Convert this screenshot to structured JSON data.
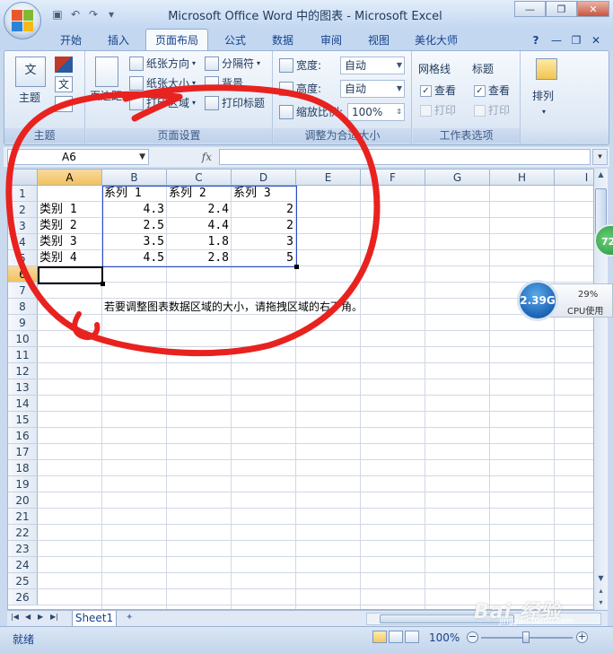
{
  "window": {
    "title": "Microsoft Office Word 中的图表 - Microsoft Excel",
    "minimize_glyph": "—",
    "restore_glyph": "❐",
    "close_glyph": "✕"
  },
  "qat": {
    "save_icon": "save-icon",
    "undo_icon": "undo-icon",
    "redo_icon": "redo-icon",
    "customize_icon": "chevron-down-icon"
  },
  "tabs": [
    {
      "label": "开始"
    },
    {
      "label": "插入"
    },
    {
      "label": "页面布局",
      "active": true
    },
    {
      "label": "公式"
    },
    {
      "label": "数据"
    },
    {
      "label": "审阅"
    },
    {
      "label": "视图"
    },
    {
      "label": "美化大师"
    }
  ],
  "ribbon": {
    "help_glyph": "?",
    "min_glyph": "—",
    "restore_glyph": "❐",
    "close_glyph": "✕",
    "themes": {
      "label": "主题",
      "btn": "主题"
    },
    "page_setup": {
      "label": "页面设置",
      "margins": "页边距",
      "orientation": "纸张方向",
      "size": "纸张大小",
      "print_area": "打印区域",
      "breaks": "分隔符",
      "background": "背景",
      "print_titles": "打印标题"
    },
    "scale": {
      "label": "调整为合适大小",
      "width_label": "宽度:",
      "width_value": "自动",
      "height_label": "高度:",
      "height_value": "自动",
      "scale_label": "缩放比例:",
      "scale_value": "100%"
    },
    "sheet_options": {
      "label": "工作表选项",
      "gridlines": "网格线",
      "headings": "标题",
      "view": "查看",
      "print": "打印"
    },
    "arrange": {
      "label": "排列"
    }
  },
  "formula_bar": {
    "name_box": "A6",
    "fx": "fx",
    "formula": ""
  },
  "sheet": {
    "columns": [
      "A",
      "B",
      "C",
      "D",
      "E",
      "F",
      "G",
      "H",
      "I"
    ],
    "rows": [
      "1",
      "2",
      "3",
      "4",
      "5",
      "6",
      "7",
      "8",
      "9",
      "10",
      "11",
      "12",
      "13",
      "14",
      "15",
      "16",
      "17",
      "18",
      "19",
      "20",
      "21",
      "22",
      "23",
      "24",
      "25",
      "26"
    ],
    "headers": [
      "系列 1",
      "系列 2",
      "系列 3"
    ],
    "data": [
      {
        "category": "类别 1",
        "values": [
          "4.3",
          "2.4",
          "2"
        ]
      },
      {
        "category": "类别 2",
        "values": [
          "2.5",
          "4.4",
          "2"
        ]
      },
      {
        "category": "类别 3",
        "values": [
          "3.5",
          "1.8",
          "3"
        ]
      },
      {
        "category": "类别 4",
        "values": [
          "4.5",
          "2.8",
          "5"
        ]
      }
    ],
    "note": "若要调整图表数据区域的大小，请拖拽区域的右下角。",
    "active_cell": "A6",
    "tab_name": "Sheet1"
  },
  "status": {
    "ready": "就绪",
    "zoom": "100%"
  },
  "overlay": {
    "cpu_value": "2.39G",
    "cpu_pct": "29%",
    "cpu_label": "CPU使用",
    "side_badge": "72",
    "watermark": "Bai 经验",
    "watermark_sub": "jingyan.baidu.com"
  },
  "colors": {
    "annotation": "#e8221f",
    "range_border": "#2a4cc3",
    "ribbon_bg": "#dde8f5"
  }
}
